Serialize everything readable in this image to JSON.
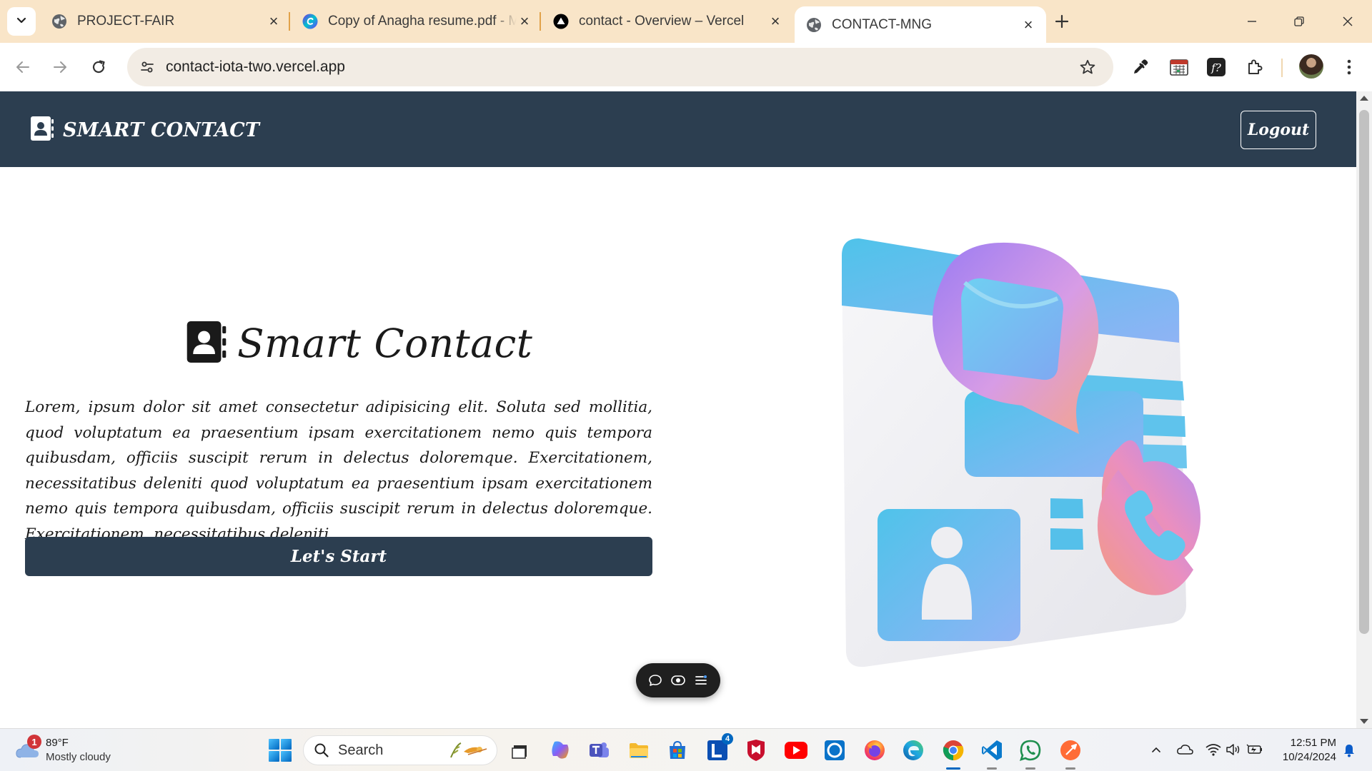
{
  "browser": {
    "tabs": [
      {
        "title": "PROJECT-FAIR",
        "favicon": "globe-icon",
        "active": false
      },
      {
        "title": "Copy of Anagha resume.pdf - M",
        "favicon": "canva-icon",
        "active": false
      },
      {
        "title": "contact - Overview – Vercel",
        "favicon": "vercel-icon",
        "active": false
      },
      {
        "title": "CONTACT-MNG",
        "favicon": "globe-icon",
        "active": true
      }
    ],
    "address": "contact-iota-two.vercel.app",
    "colors": {
      "tabstrip": "#f9e5c8",
      "omnibox": "#f2ece4"
    }
  },
  "app": {
    "brand": "SMART CONTACT",
    "logout_label": "Logout",
    "colors": {
      "navbar": "#2c3e50",
      "button": "#2c3e50"
    }
  },
  "hero": {
    "title": "Smart Contact",
    "paragraph": "Lorem, ipsum dolor sit amet consectetur adipisicing elit. Soluta sed mollitia, quod voluptatum ea praesentium ipsam exercitationem nemo quis tempora quibusdam, officiis suscipit rerum in delectus doloremque. Exercitationem, necessitatibus deleniti quod voluptatum ea praesentium ipsam exercitationem nemo quis tempora quibusdam, officiis suscipit rerum in delectus doloremque. Exercitationem, necessitatibus deleniti.",
    "cta_label": "Let's Start"
  },
  "taskbar": {
    "weather": {
      "temp": "89°F",
      "condition": "Mostly cloudy",
      "badge": "1"
    },
    "search_label": "Search",
    "apps": [
      "file-explorer-icon",
      "copilot-icon",
      "teams-icon",
      "folder-icon",
      "store-icon",
      "l-app-icon",
      "mcafee-icon",
      "youtube-icon",
      "app-icon",
      "firefox-icon",
      "edge-icon",
      "chrome-icon",
      "vscode-icon",
      "whatsapp-icon",
      "postman-icon"
    ],
    "l_app_badge": "4",
    "clock": {
      "time": "12:51 PM",
      "date": "10/24/2024"
    }
  }
}
